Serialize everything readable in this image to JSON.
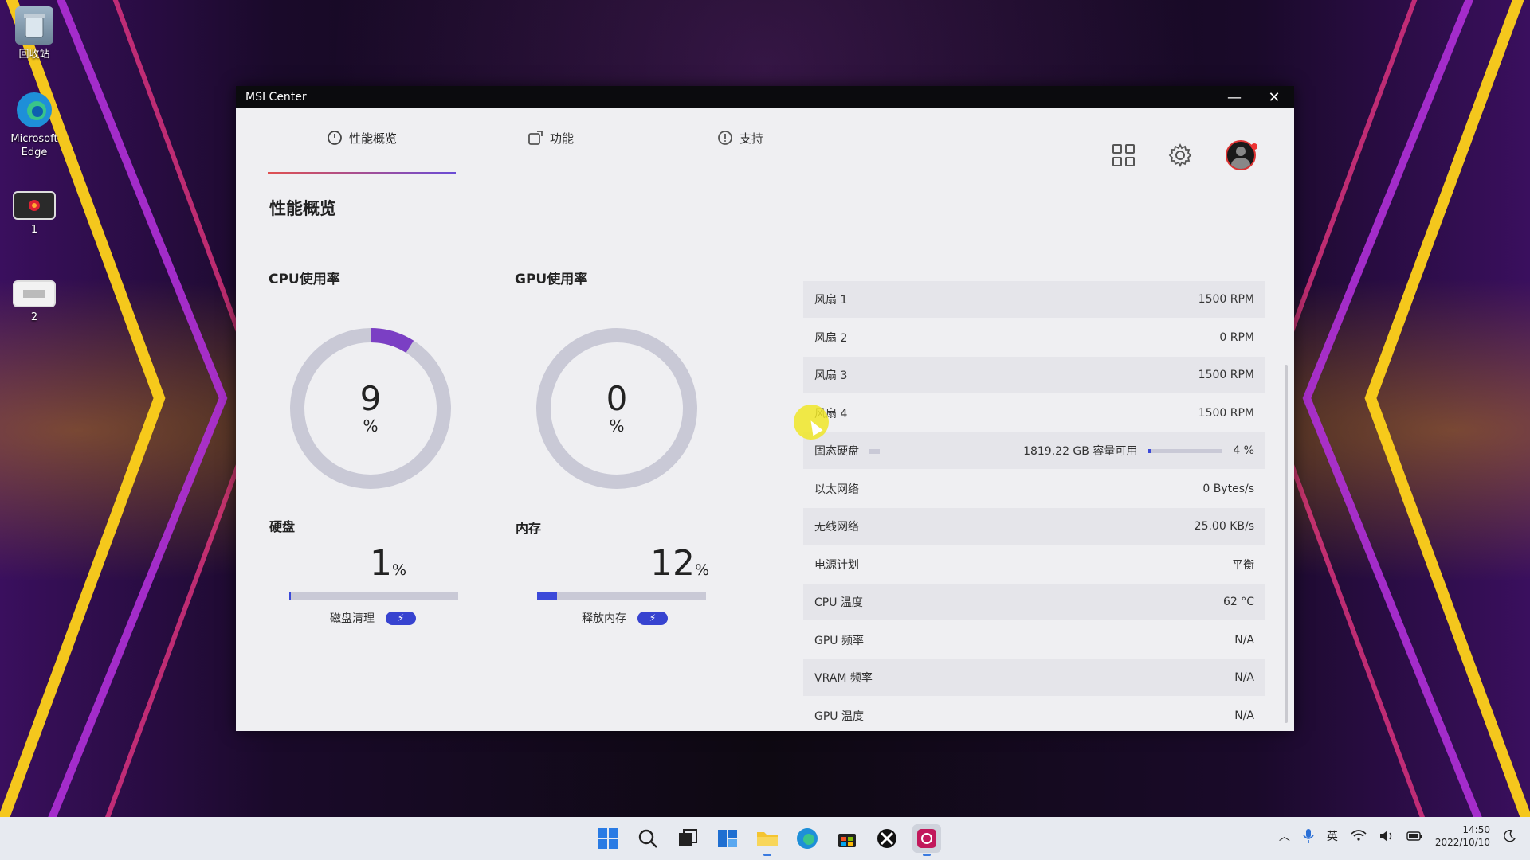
{
  "desktop": {
    "icons": [
      {
        "label": "回收站",
        "icon": "recycle-bin-icon"
      },
      {
        "label": "Microsoft Edge",
        "icon": "edge-icon"
      },
      {
        "label": "1",
        "icon": "video-file-icon"
      },
      {
        "label": "2",
        "icon": "video-file-icon"
      }
    ]
  },
  "window": {
    "title": "MSI Center",
    "minimize": "—",
    "close": "✕"
  },
  "nav": {
    "tabs": [
      {
        "label": "性能概览",
        "icon": "performance-icon",
        "active": true
      },
      {
        "label": "功能",
        "icon": "features-icon",
        "active": false
      },
      {
        "label": "支持",
        "icon": "support-icon",
        "active": false
      }
    ]
  },
  "page": {
    "title": "性能概览",
    "cpu": {
      "label": "CPU使用率",
      "value": "9",
      "unit": "%",
      "percent": 9
    },
    "gpu": {
      "label": "GPU使用率",
      "value": "0",
      "unit": "%",
      "percent": 0
    },
    "disk": {
      "label": "硬盘",
      "value": "1",
      "unit": "%",
      "percent": 1,
      "action": "磁盘清理"
    },
    "memory": {
      "label": "内存",
      "value": "12",
      "unit": "%",
      "percent": 12,
      "action": "释放内存"
    }
  },
  "stats": [
    {
      "label": "风扇 1",
      "value": "1500 RPM"
    },
    {
      "label": "风扇 2",
      "value": "0 RPM"
    },
    {
      "label": "风扇 3",
      "value": "1500 RPM"
    },
    {
      "label": "风扇 4",
      "value": "1500 RPM"
    },
    {
      "label": "固态硬盘",
      "value": "4 %",
      "detail": "1819.22 GB 容量可用",
      "percent": 4
    },
    {
      "label": "以太网络",
      "value": "0 Bytes/s"
    },
    {
      "label": "无线网络",
      "value": "25.00 KB/s"
    },
    {
      "label": "电源计划",
      "value": "平衡"
    },
    {
      "label": "CPU 温度",
      "value": "62 °C"
    },
    {
      "label": "GPU 频率",
      "value": "N/A"
    },
    {
      "label": "VRAM 频率",
      "value": "N/A"
    },
    {
      "label": "GPU 温度",
      "value": "N/A"
    }
  ],
  "colors": {
    "accent": "#3b49d9",
    "gauge_track": "#c9c9d6",
    "gauge_fill": "#7b3fc4"
  },
  "tray": {
    "ime": "英",
    "time": "14:50",
    "date": "2022/10/10"
  }
}
